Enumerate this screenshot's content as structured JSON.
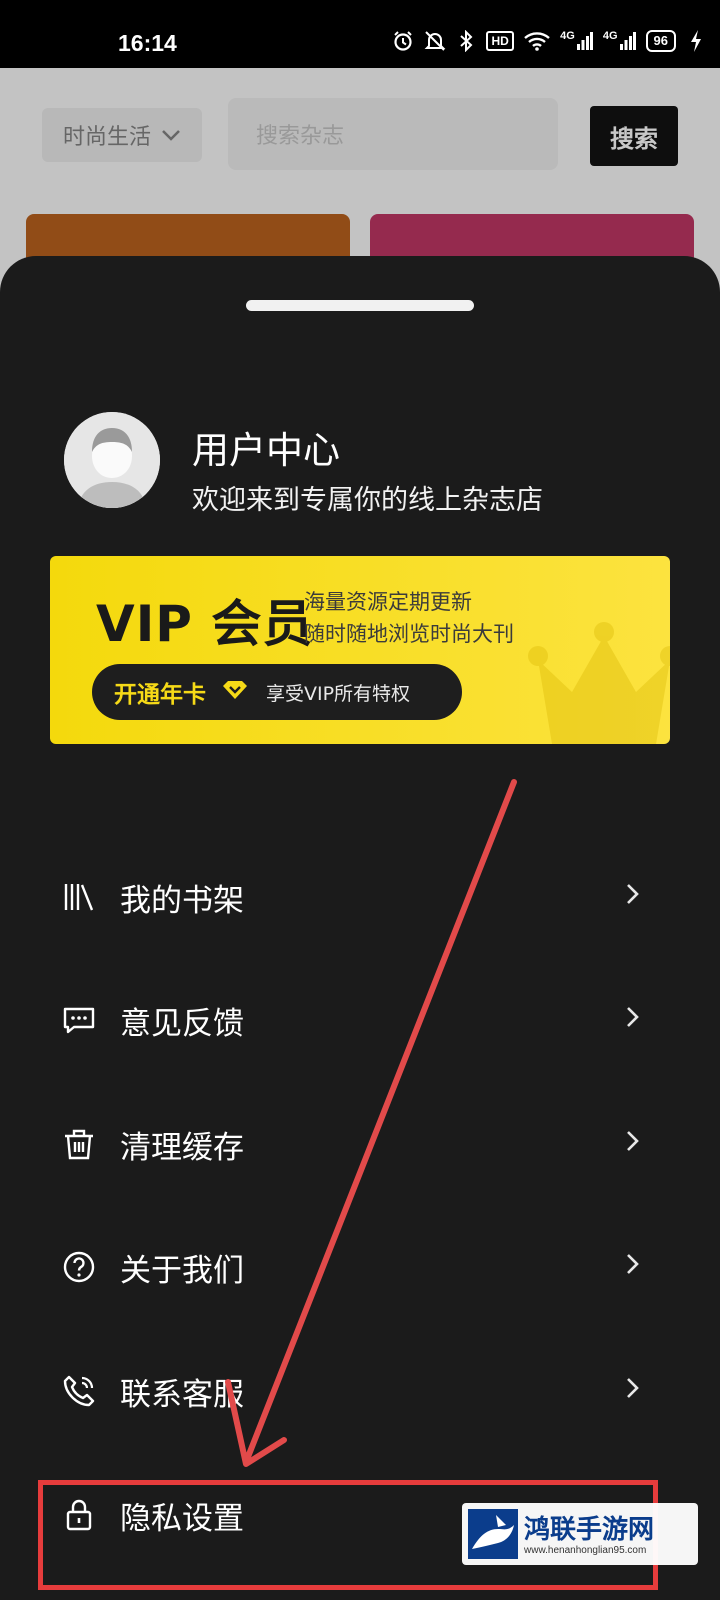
{
  "status_bar": {
    "time": "16:14",
    "icons": [
      "alarm-icon",
      "mute-icon",
      "bluetooth-icon",
      "hd-icon",
      "wifi-icon",
      "signal-4g-icon",
      "signal-4g-icon",
      "battery-icon",
      "charging-icon"
    ],
    "hd_label": "HD",
    "net1": "4G",
    "net2": "4G",
    "battery": "96"
  },
  "background_page": {
    "category": "时尚生活",
    "search_placeholder": "搜索杂志",
    "search_button": "搜索"
  },
  "user_center": {
    "title": "用户中心",
    "subtitle": "欢迎来到专属你的线上杂志店"
  },
  "vip": {
    "title": "VIP 会员",
    "line1": "海量资源定期更新",
    "line2": "随时随地浏览时尚大刊",
    "cta": "开通年卡",
    "cta_sub": "享受VIP所有特权"
  },
  "menu": [
    {
      "label": "我的书架",
      "icon": "bookshelf-icon"
    },
    {
      "label": "意见反馈",
      "icon": "feedback-icon"
    },
    {
      "label": "清理缓存",
      "icon": "trash-icon"
    },
    {
      "label": "关于我们",
      "icon": "question-icon"
    },
    {
      "label": "联系客服",
      "icon": "phone-icon"
    },
    {
      "label": "隐私设置",
      "icon": "lock-icon"
    }
  ],
  "watermark": {
    "title": "鸿联手游网",
    "url": "www.henanhonglian95.com"
  },
  "colors": {
    "sheet_bg": "#1b1b1b",
    "vip_yellow": "#f6da17",
    "annotation_red": "#e63c3c"
  }
}
